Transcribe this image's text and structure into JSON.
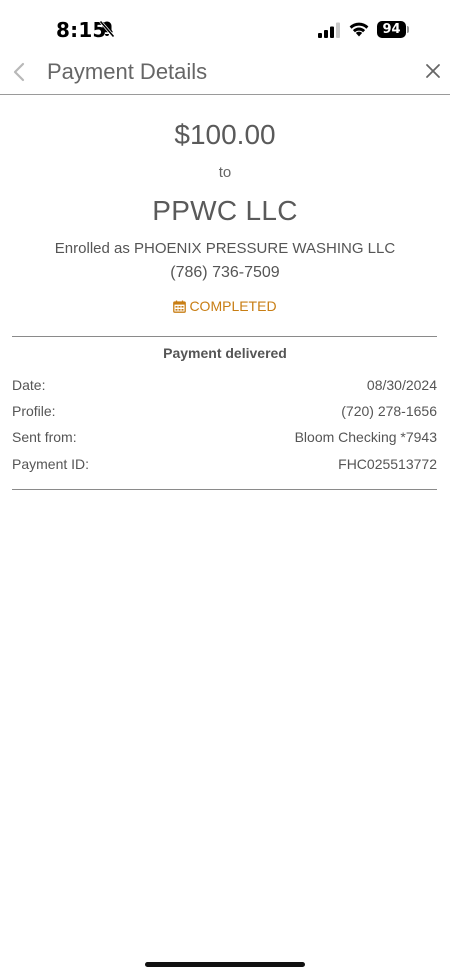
{
  "status_bar": {
    "time": "8:15",
    "battery": "94",
    "icons": [
      "bell-slash-icon",
      "signal-icon",
      "wifi-icon",
      "battery-icon"
    ]
  },
  "header": {
    "title": "Payment Details",
    "back_icon": "chevron-left-icon",
    "close_icon": "close-icon"
  },
  "payment": {
    "amount": "$100.00",
    "to_label": "to",
    "payee_name": "PPWC LLC",
    "enrolled_as": "Enrolled as PHOENIX PRESSURE WASHING LLC",
    "payee_phone": "(786) 736-7509",
    "status": "COMPLETED",
    "status_icon": "calendar-icon",
    "status_color": "#c87e14"
  },
  "details": {
    "heading": "Payment delivered",
    "rows": [
      {
        "label": "Date:",
        "value": "08/30/2024"
      },
      {
        "label": "Profile:",
        "value": "(720) 278-1656"
      },
      {
        "label": "Sent from:",
        "value": "Bloom Checking *7943"
      },
      {
        "label": "Payment ID:",
        "value": "FHC025513772"
      }
    ]
  }
}
